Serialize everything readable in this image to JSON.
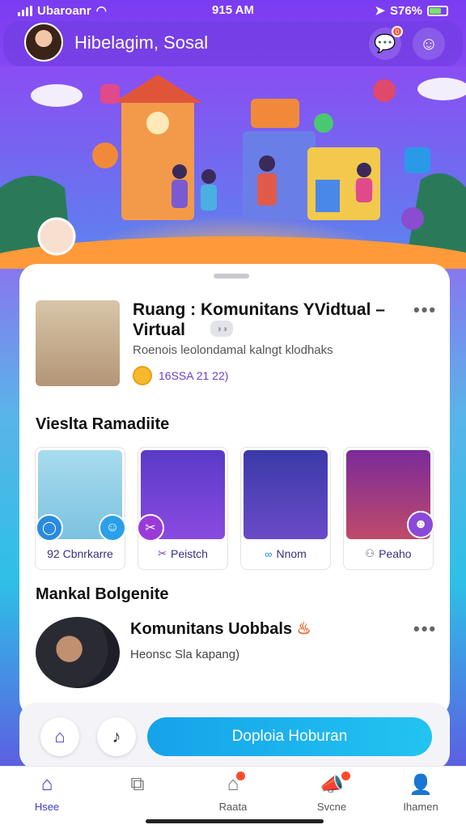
{
  "status": {
    "carrier": "Ubaroanr",
    "time": "915 AM",
    "battery": "S76%"
  },
  "header": {
    "greeting": "Hibelagim, Sosal",
    "chat_badge": "0"
  },
  "featured": {
    "title": "Ruang : Komunitans YVidtual –\nVirtual",
    "subtitle": "Roenois leolondamal kalngt klodhaks",
    "meta": "16SSA 21 22)"
  },
  "section_recommend": {
    "title": "Vieslta Ramadiite"
  },
  "cards": [
    {
      "label": "92 Cbnrkarre",
      "icon": "chat-icon"
    },
    {
      "label": "Peistch",
      "icon": "scissors-icon"
    },
    {
      "label": "Nnom",
      "icon": "link-icon"
    },
    {
      "label": "Peaho",
      "icon": "group-icon"
    }
  ],
  "section_new": {
    "title": "Mankal Bolgenite"
  },
  "community": {
    "title": "Komunitans Uobbals",
    "subtitle": "Heonsc Sla kapang)"
  },
  "cta": {
    "label": "Doploia Hoburan"
  },
  "tabs": [
    {
      "label": "Hsee",
      "icon": "home-icon",
      "active": true
    },
    {
      "label": "",
      "icon": "puzzle-icon",
      "active": false
    },
    {
      "label": "Raata",
      "icon": "store-icon",
      "active": false
    },
    {
      "label": "Svcne",
      "icon": "megaphone-icon",
      "active": false
    },
    {
      "label": "Ihamen",
      "icon": "profile-icon",
      "active": false
    }
  ],
  "colors": {
    "accent": "#3f3ad0",
    "cta": "#16a2ea",
    "badge": "#ff4a2a"
  }
}
